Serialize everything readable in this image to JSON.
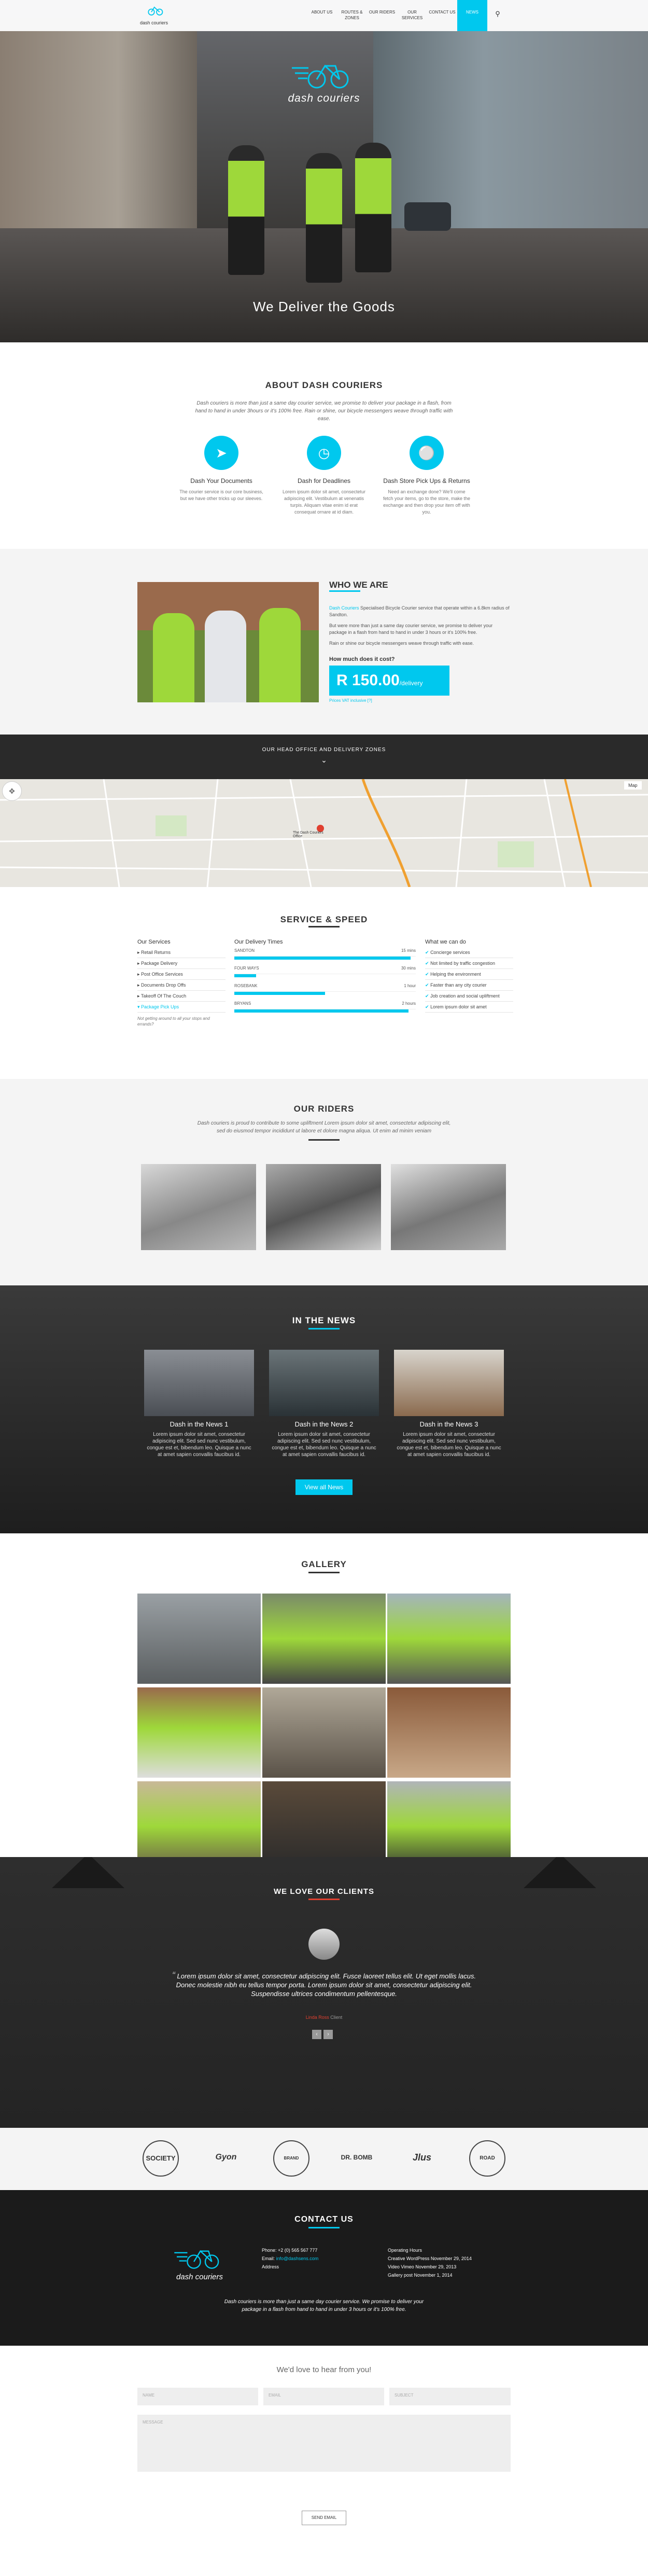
{
  "nav": {
    "logo_text": "dash couriers",
    "items": [
      {
        "label": "ABOUT US"
      },
      {
        "label": "ROUTES & ZONES"
      },
      {
        "label": "OUR RIDERS"
      },
      {
        "label": "OUR SERVICES"
      },
      {
        "label": "CONTACT US"
      },
      {
        "label": "NEWS",
        "active": true
      }
    ],
    "search_icon": "search-icon"
  },
  "hero": {
    "logo_text": "dash couriers",
    "tagline": "We Deliver the Goods"
  },
  "about": {
    "title": "ABOUT DASH COURIERS",
    "intro": "Dash couriers is more than just a same day courier service, we promise to deliver your package in a flash, from hand to hand in under 3hours or it's 100% free. Rain or shine, our bicycle messengers weave through traffic with ease.",
    "features": [
      {
        "icon": "paper-plane-icon",
        "title": "Dash Your Documents",
        "desc": "The courier service is our core business, but we have other tricks up our sleeves."
      },
      {
        "icon": "stopwatch-icon",
        "title": "Dash for Deadlines",
        "desc": "Lorem ipsum dolor sit amet, consectetur adipiscing elit. Vestibulum at venenatis turpis. Aliquam vitae enim id erat consequat ornare at id diam."
      },
      {
        "icon": "bicycle-icon",
        "title": "Dash Store Pick Ups & Returns",
        "desc": "Need an exchange done? We'll come fetch your items, go to the store, make the exchange and then drop your item off with you."
      }
    ]
  },
  "who": {
    "title": "WHO WE ARE",
    "body_link": "Dash Couriers",
    "body1": " Specialised Bicycle Courier service that operate within a 6.8km radius of Sandton.",
    "body2": "But were more than just a same day courier service, we promise to deliver your package in a flash from hand to hand in under 3 hours or it's 100% free.",
    "body3": "Rain or shine our bicycle messengers weave through traffic with ease.",
    "cost_q": "How much does it cost?",
    "price": "R 150.00",
    "price_suffix": "/delivery",
    "vat_note": "Prices VAT inclusive [?]"
  },
  "map_bar": {
    "label": "OUR HEAD OFFICE AND DELIVERY ZONES",
    "chevron_icon": "chevron-down-icon",
    "map_label": "The Dash Couriers\nOffice",
    "map_btn": "Map"
  },
  "service": {
    "title": "SERVICE & SPEED",
    "services_heading": "Our Services",
    "services": [
      "Retail Returns",
      "Package Delivery",
      "Post Office Services",
      "Documents Drop Offs",
      "Takeoff Of The Couch",
      "Package Pick Ups"
    ],
    "services_note": "Not getting around to all your stops and errands?",
    "times_heading": "Our Delivery Times",
    "times": [
      {
        "label": "SANDTON",
        "value": "15 mins",
        "pct": 0.97
      },
      {
        "label": "FOUR WAYS",
        "value": "30 mins",
        "pct": 0.12
      },
      {
        "label": "ROSEBANK",
        "value": "1 hour",
        "pct": 0.5
      },
      {
        "label": "BRYANS",
        "value": "2 hours",
        "pct": 0.96
      }
    ],
    "cando_heading": "What we can do",
    "cando": [
      "Concierge services",
      "Not limited by traffic congestion",
      "Helping the environment",
      "Faster than any city courier",
      "Job creation and social upliftment",
      "Lorem ipsum dolor sit amet"
    ]
  },
  "riders": {
    "title": "OUR RIDERS",
    "intro": "Dash couriers is proud to contribute to some upliftment Lorem ipsum dolor sit amet, consectetur adipiscing elit, sed do eiusmod tempor incididunt ut labore et dolore magna aliqua. Ut enim ad minim veniam"
  },
  "news": {
    "title": "IN THE NEWS",
    "items": [
      {
        "title": "Dash in the News 1",
        "body": "Lorem ipsum dolor sit amet, consectetur adipiscing elit. Sed sed nunc vestibulum, congue est et, bibendum leo. Quisque a nunc at amet sapien convallis faucibus id."
      },
      {
        "title": "Dash in the News 2",
        "body": "Lorem ipsum dolor sit amet, consectetur adipiscing elit. Sed sed nunc vestibulum, congue est et, bibendum leo. Quisque a nunc at amet sapien convallis faucibus id."
      },
      {
        "title": "Dash in the News 3",
        "body": "Lorem ipsum dolor sit amet, consectetur adipiscing elit. Sed sed nunc vestibulum, congue est et, bibendum leo. Quisque a nunc at amet sapien convallis faucibus id."
      }
    ],
    "view_all": "View all News"
  },
  "gallery": {
    "title": "GALLERY"
  },
  "clients": {
    "title": "WE LOVE OUR CLIENTS",
    "quote": "Lorem ipsum dolor sit amet, consectetur adipiscing elit. Fusce laoreet tellus elit. Ut eget mollis lacus. Donec molestie nibh eu tellus tempor porta. Lorem ipsum dolor sit amet, consectetur adipiscing elit. Suspendisse ultrices condimentum pellentesque.",
    "author": "Linda Ross",
    "author_role": "Client"
  },
  "brands": [
    "SOCIETY",
    "Gyon",
    "BRAND",
    "DR. BOMB",
    "Jlus",
    "ROAD"
  ],
  "contact": {
    "title": "CONTACT US",
    "logo_text": "dash couriers",
    "phone_label": "Phone:",
    "phone": "+2 (0) 565 567 777",
    "email_label": "Email:",
    "email": "info@dashsens.com",
    "address_label": "Address",
    "hours_heading": "Operating Hours",
    "hours": [
      "Creative WordPress November 29, 2014",
      "Video Vimeo November 29, 2013",
      "Gallery post November 1, 2014"
    ],
    "tagline": "Dash couriers is more than just a same day courier service. We promise to deliver your package in a flash from hand to hand in under 3 hours or it's 100% free."
  },
  "form": {
    "heading": "We'd love to hear from you!",
    "name_ph": "NAME",
    "email_ph": "EMAIL",
    "subject_ph": "SUBJECT",
    "message_ph": "MESSAGE",
    "send": "SEND EMAIL"
  },
  "colors": {
    "accent": "#00c8ee",
    "dark": "#2a2a2a",
    "green": "#9ed83a"
  }
}
